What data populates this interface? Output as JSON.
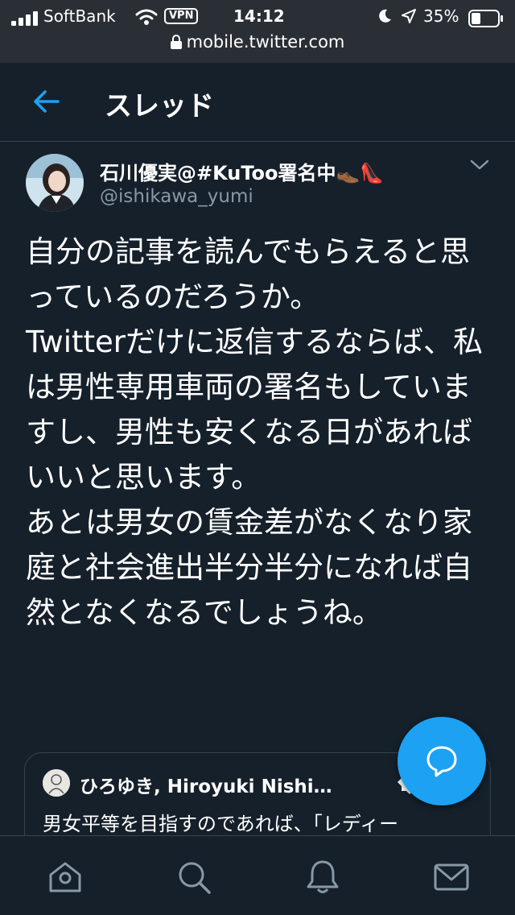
{
  "status_bar": {
    "carrier": "SoftBank",
    "vpn": "VPN",
    "time": "14:12",
    "battery": "35%",
    "battery_level": 0.35,
    "url": "mobile.twitter.com"
  },
  "header": {
    "title": "スレッド",
    "back_icon": "back-arrow-icon"
  },
  "tweet": {
    "author_name": "石川優実@#KuToo署名中",
    "name_emoji": "👞👠",
    "handle": "@ishikawa_yumi",
    "text": "自分の記事を読んでもらえると思っているのだろうか。\nTwitterだけに返信するならば、私は男性専用車両の署名もしていますし、男性も安くなる日があればいいと思います。\nあとは男女の賃金差がなくなり家庭と社会進出半分半分になれば自然となくなるでしょうね。"
  },
  "quoted_tweet": {
    "author_name": "ひろゆき, Hiroyuki Nishi…",
    "text": "男女平等を目指すのであれば、「レディー"
  },
  "colors": {
    "background": "#15202b",
    "accent": "#1da1f2",
    "secondary_text": "#8899a6",
    "border": "#38444d"
  },
  "icons": {
    "compose": "reply-bubble-icon",
    "nav": [
      "home-icon",
      "search-icon",
      "notifications-bell-icon",
      "messages-envelope-icon"
    ]
  }
}
